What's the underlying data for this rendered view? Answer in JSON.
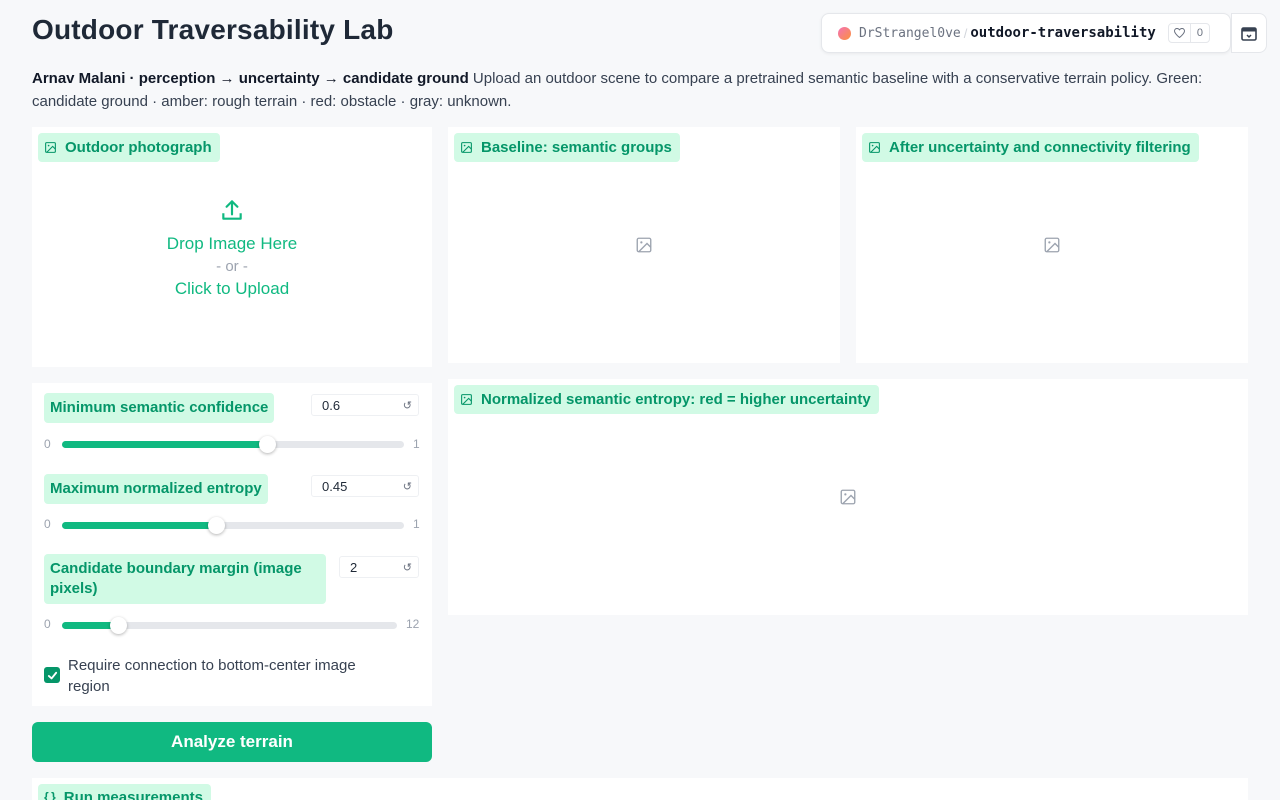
{
  "header": {
    "title": "Outdoor Traversability Lab",
    "description_bold": "Arnav Malani · perception → uncertainty → candidate ground",
    "description_text": " Upload an outdoor scene to compare a pretrained semantic baseline with a conservative terrain policy. Green: candidate ground · amber: rough terrain · red: obstacle · gray: unknown."
  },
  "hf_badge": {
    "user": "DrStrangel0ve",
    "separator": "/",
    "repo": "outdoor-traversability",
    "likes": "0"
  },
  "panels": {
    "input": {
      "label": "Outdoor photograph",
      "drop_text": "Drop Image Here",
      "or_text": "- or -",
      "click_text": "Click to Upload"
    },
    "baseline": {
      "label": "Baseline: semantic groups"
    },
    "filtered": {
      "label": "After uncertainty and connectivity filtering"
    },
    "entropy": {
      "label": "Normalized semantic entropy: red = higher uncertainty"
    },
    "measurements": {
      "label": "Run measurements"
    }
  },
  "controls": {
    "confidence": {
      "label": "Minimum semantic confidence",
      "value": "0.6",
      "min": "0",
      "max": "1",
      "fraction": 0.6
    },
    "entropy": {
      "label": "Maximum normalized entropy",
      "value": "0.45",
      "min": "0",
      "max": "1",
      "fraction": 0.45
    },
    "margin": {
      "label": "Candidate boundary margin (image pixels)",
      "value": "2",
      "min": "0",
      "max": "12",
      "fraction": 0.1667
    },
    "reset_glyph": "↺",
    "connection_checkbox": {
      "label": "Require connection to bottom-center image region",
      "checked": true
    },
    "analyze_button": "Analyze terrain"
  },
  "colors": {
    "accent": "#10b981",
    "accent_dark": "#059669",
    "label_bg": "#d1fae5"
  }
}
